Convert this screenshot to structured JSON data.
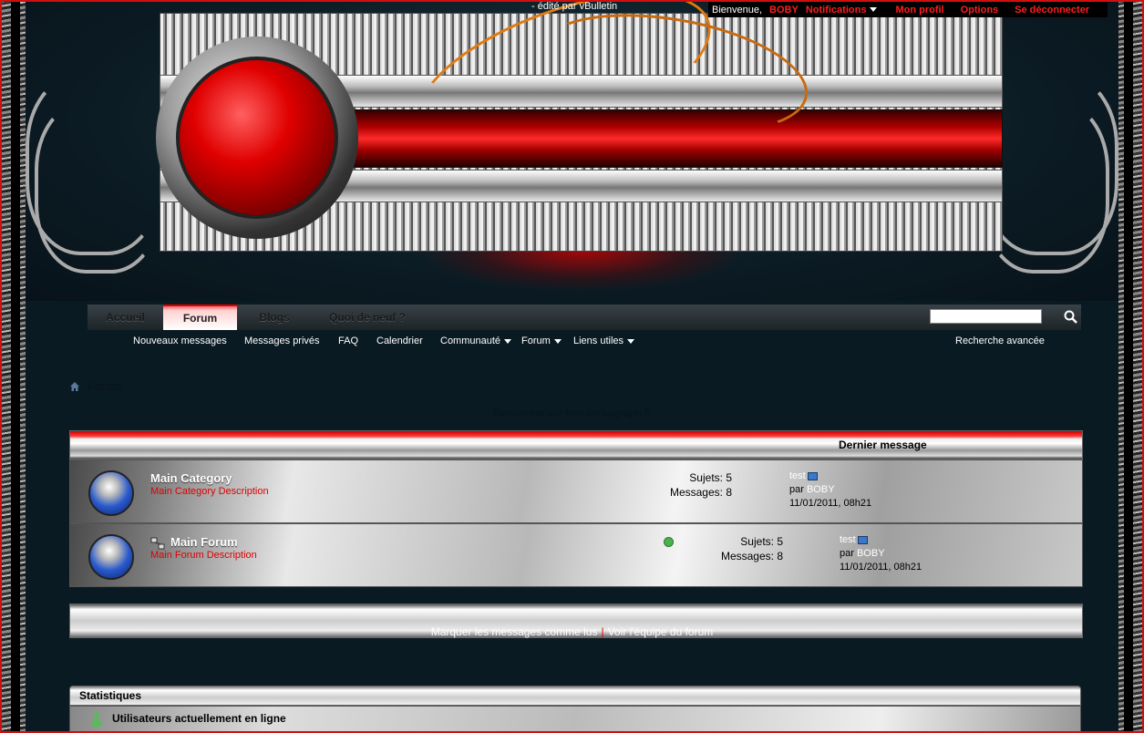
{
  "header": {
    "edited_by": "- édité par vBulletin"
  },
  "userbar": {
    "welcome": "Bienvenue,",
    "username": "BOBY",
    "notifications": "Notifications",
    "profile": "Mon profil",
    "options": "Options",
    "logout": "Se déconnecter"
  },
  "nav": {
    "tabs": [
      {
        "label": "Accueil"
      },
      {
        "label": "Forum"
      },
      {
        "label": "Blogs"
      },
      {
        "label": "Quoi de neuf ?"
      }
    ],
    "active_tab": "Forum",
    "search_placeholder": ""
  },
  "subnav": {
    "items": [
      {
        "label": "Nouveaux messages"
      },
      {
        "label": "Messages privés"
      },
      {
        "label": "FAQ"
      },
      {
        "label": "Calendrier"
      },
      {
        "label": "Communauté"
      },
      {
        "label": "Forum"
      },
      {
        "label": "Liens utiles"
      }
    ],
    "advanced_search": "Recherche avancée"
  },
  "breadcrumb": {
    "current": "Forum"
  },
  "welcome_banner": "Bienvenue sur test.verbagraph.fr",
  "forum_table": {
    "last_post_header": "Dernier message",
    "rows": [
      {
        "title": "Main Category",
        "description": "Main Category Description",
        "threads_label": "Sujets: 5",
        "posts_label": "Messages: 8",
        "last_post_title": "test",
        "last_post_by_label": "par",
        "last_post_user": "BOBY",
        "last_post_date": "11/01/2011, 08h21"
      },
      {
        "title": "Main Forum",
        "description": "Main Forum Description",
        "threads_label": "Sujets: 5",
        "posts_label": "Messages: 8",
        "last_post_title": "test",
        "last_post_by_label": "par",
        "last_post_user": "BOBY",
        "last_post_date": "11/01/2011, 08h21"
      }
    ]
  },
  "footer_links": {
    "mark_read": "Marquer les messages comme lus",
    "staff": "Voir l'équipe du forum"
  },
  "stats": {
    "title": "Statistiques",
    "online_users": "Utilisateurs actuellement en ligne"
  },
  "colors": {
    "accent": "#e00000",
    "link_red": "#ff1e1e"
  }
}
